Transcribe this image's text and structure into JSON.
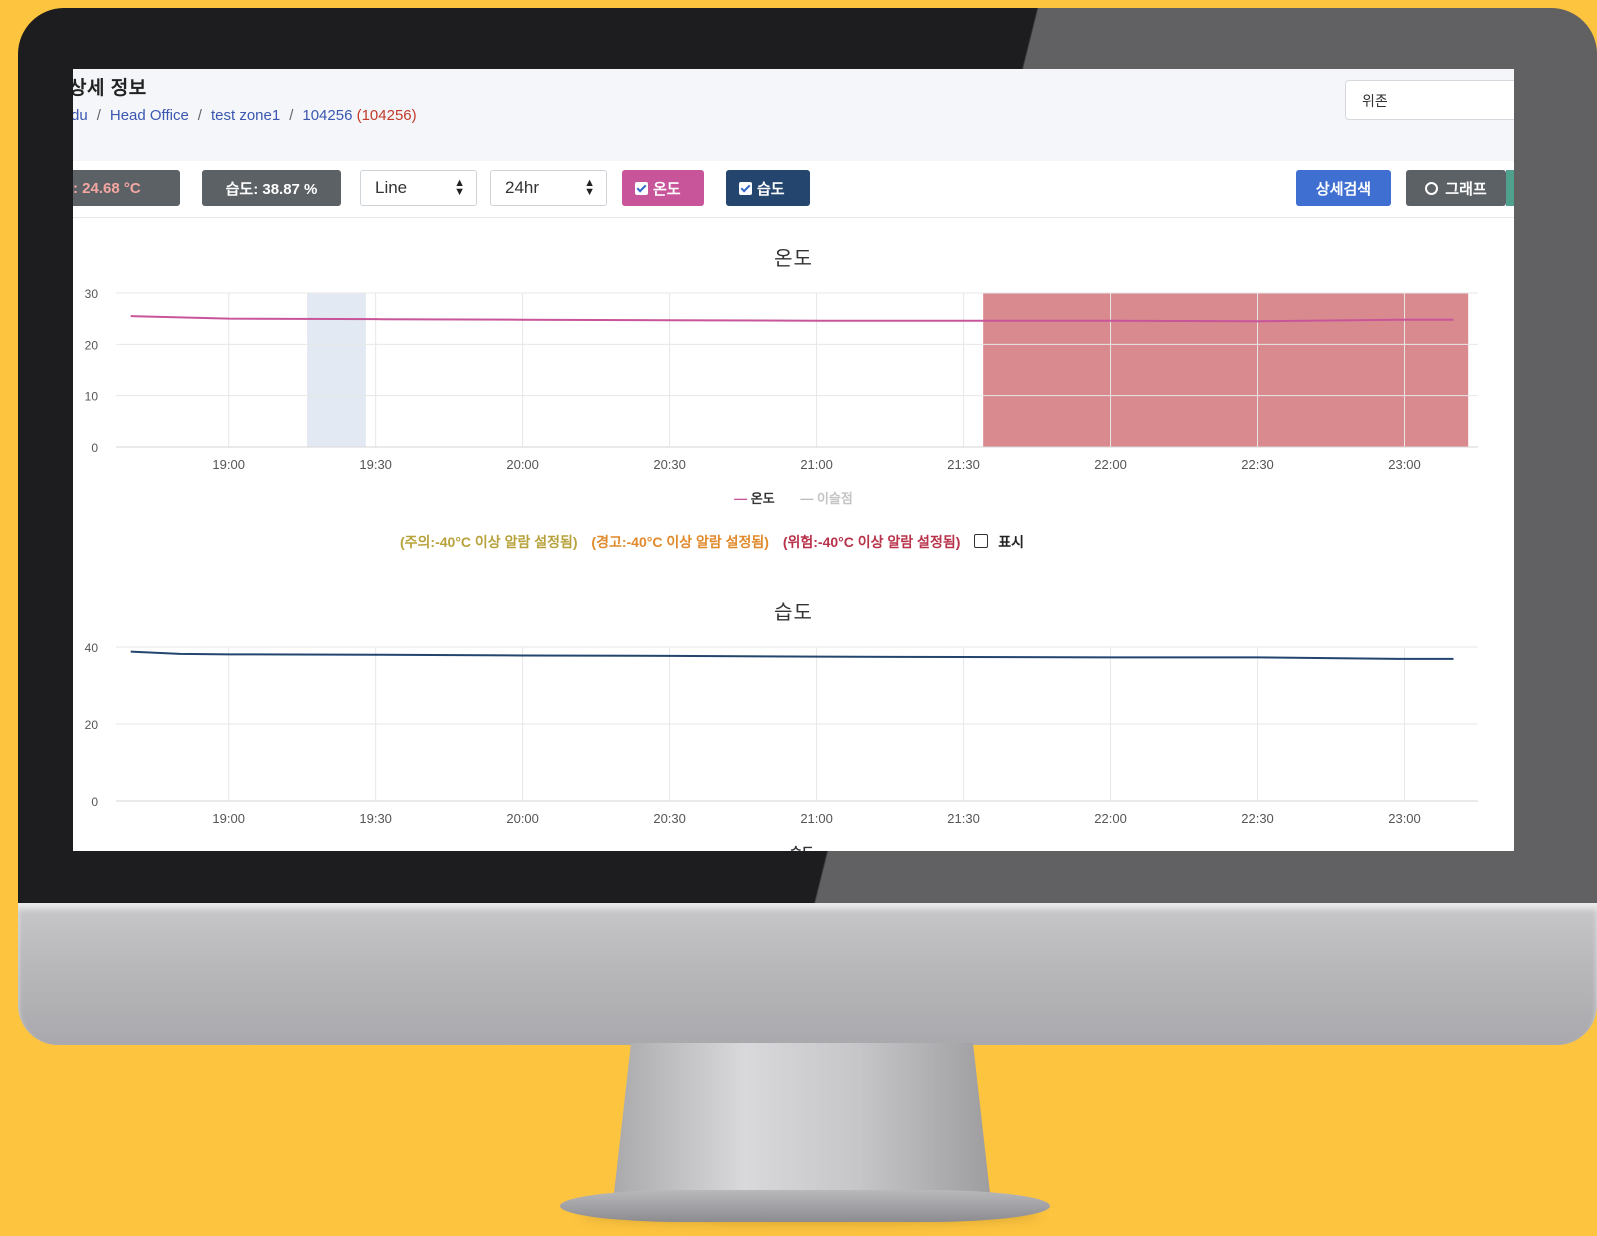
{
  "header": {
    "title": "상세 정보",
    "breadcrumb": [
      "du",
      "Head Office",
      "test zone1",
      "104256"
    ],
    "breadcrumb_suffix": "(104256)",
    "zone_select": "위존"
  },
  "toolbar": {
    "temp_reading": ": 24.68 °C",
    "humidity_reading": "습도: 38.87 %",
    "chart_type": "Line",
    "time_range": "24hr",
    "temp_toggle": "온도",
    "humidity_toggle": "습도",
    "detail_search": "상세검색",
    "graph_button": "그래프"
  },
  "alarms": {
    "caution": "(주의:-40°C 이상 알람 설정됨)",
    "warning": "(경고:-40°C 이상 알람 설정됨)",
    "danger": "(위험:-40°C 이상 알람 설정됨)",
    "show_label": "표시"
  },
  "colors": {
    "temp_line": "#c8559a",
    "humidity_line": "#23456e",
    "danger_band": "#d98a8f",
    "low_band": "#e3e9f2",
    "caution_text": "#b8a23c",
    "warning_text": "#e08a2c",
    "danger_text": "#b8324a"
  },
  "chart_data": [
    {
      "type": "line",
      "title": "온도",
      "x_ticks": [
        "19:00",
        "19:30",
        "20:00",
        "20:30",
        "21:00",
        "21:30",
        "22:00",
        "22:30",
        "23:00"
      ],
      "y_ticks": [
        0,
        10,
        20,
        30
      ],
      "ylim": [
        0,
        30
      ],
      "xlim": [
        "18:37",
        "23:15"
      ],
      "legend": [
        "온도",
        "이슬점"
      ],
      "series": [
        {
          "name": "온도",
          "x": [
            "18:40",
            "19:00",
            "19:30",
            "20:00",
            "20:30",
            "21:00",
            "21:30",
            "22:00",
            "22:30",
            "23:00",
            "23:10"
          ],
          "values": [
            25.5,
            25.0,
            24.9,
            24.8,
            24.7,
            24.6,
            24.6,
            24.6,
            24.5,
            24.8,
            24.8
          ]
        }
      ],
      "bands": [
        {
          "kind": "low",
          "from": "19:16",
          "to": "19:28"
        },
        {
          "kind": "danger",
          "from": "21:34",
          "to": "23:13"
        }
      ]
    },
    {
      "type": "line",
      "title": "습도",
      "x_ticks": [
        "19:00",
        "19:30",
        "20:00",
        "20:30",
        "21:00",
        "21:30",
        "22:00",
        "22:30",
        "23:00"
      ],
      "y_ticks": [
        0,
        20,
        40
      ],
      "ylim": [
        0,
        40
      ],
      "xlim": [
        "18:37",
        "23:15"
      ],
      "legend": [
        "습도"
      ],
      "series": [
        {
          "name": "습도",
          "x": [
            "18:40",
            "18:50",
            "19:00",
            "19:30",
            "20:00",
            "20:30",
            "21:00",
            "21:30",
            "22:00",
            "22:30",
            "23:00",
            "23:10"
          ],
          "values": [
            38.8,
            38.2,
            38.1,
            38.0,
            37.8,
            37.7,
            37.5,
            37.4,
            37.3,
            37.3,
            36.9,
            36.9
          ]
        }
      ]
    }
  ]
}
